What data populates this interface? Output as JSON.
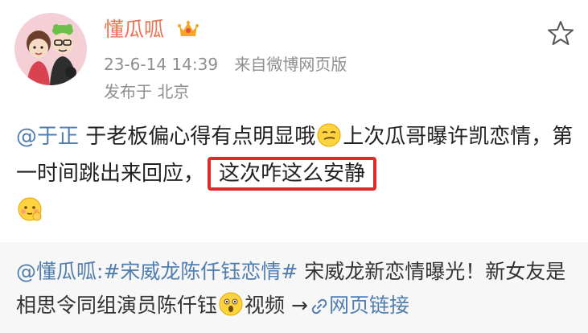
{
  "author": {
    "name": "懂瓜呱",
    "timestamp": "23-6-14 14:39",
    "source": "来自微博网页版",
    "location": "发布于 北京"
  },
  "post": {
    "mention": "@于正",
    "text_part1": " 于老板偏心得有点明显哦",
    "text_part2": "上次瓜哥曝许凯恋情，第一时间跳出来回应，",
    "highlighted_text": "这次咋这么安静"
  },
  "repost": {
    "mention": "@懂瓜呱:",
    "hashtag": "#宋威龙陈仟钰恋情#",
    "text_part1": " 宋威龙新恋情曝光！新女友是相思令同组演员陈仟钰",
    "video_label": "视频",
    "arrow": " →",
    "link_label": "网页链接"
  },
  "icons": {
    "star": "star-outline-icon",
    "crown": "crown-icon",
    "emoji1": "smirk-emoji-icon",
    "emoji2": "cute-emoji-icon",
    "emoji3": "shocked-emoji-icon",
    "link": "link-icon"
  },
  "colors": {
    "username": "#eb7350",
    "link": "#507daf",
    "highlight_border": "#e02a2a",
    "repost_bg": "#f7f7f7"
  }
}
